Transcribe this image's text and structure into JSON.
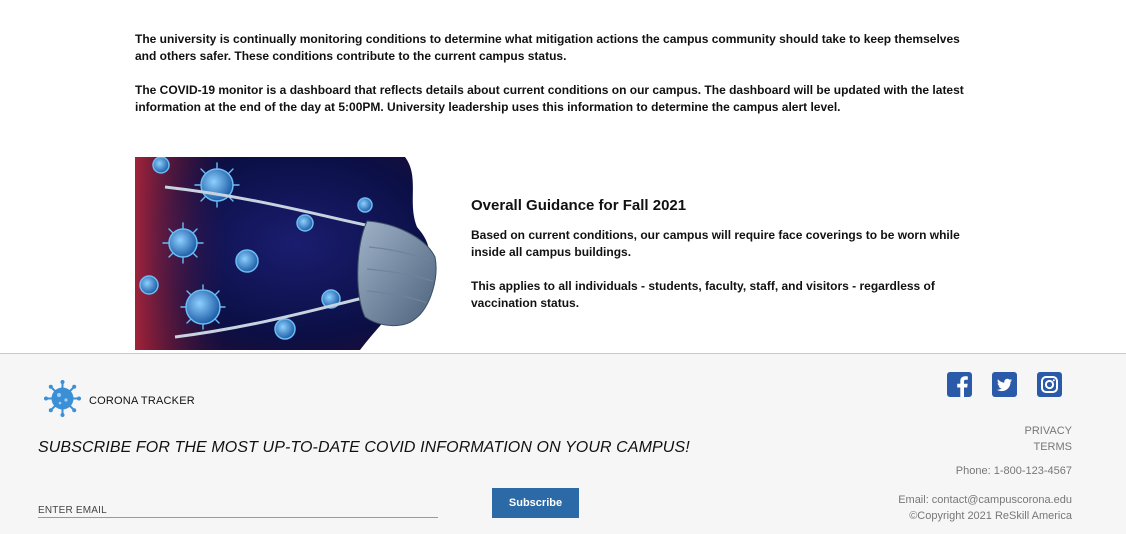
{
  "intro": {
    "paragraph_1": "The university is continually monitoring conditions to determine what mitigation actions the campus community should take to keep themselves and others safer. These conditions contribute to the current campus status.",
    "paragraph_2": "The COVID-19 monitor is a dashboard that reflects details about current conditions on our campus. The dashboard will be updated with the latest information at the end of the day at 5:00PM. University leadership uses this information to determine the campus alert level."
  },
  "guidance": {
    "title": "Overall Guidance for Fall 2021",
    "paragraph_1": "Based on current conditions, our campus will require face coverings to be worn while inside all campus buildings.",
    "paragraph_2": "This applies to all individuals - students, faculty, staff, and visitors - regardless of vaccination status."
  },
  "footer": {
    "brand_name": "CORONA TRACKER",
    "subscribe_heading": "SUBSCRIBE FOR THE MOST UP-TO-DATE COVID INFORMATION ON YOUR CAMPUS!",
    "email_placeholder": "ENTER EMAIL",
    "subscribe_label": "Subscribe",
    "links": [
      "PRIVACY",
      "TERMS"
    ],
    "phone": "Phone: 1-800-123-4567",
    "email": "Email: contact@campuscorona.edu",
    "copyright": "©Copyright 2021 ReSkill America",
    "social_icons": [
      "facebook-icon",
      "twitter-icon",
      "instagram-icon"
    ]
  },
  "colors": {
    "accent": "#2c6aa7",
    "social_icon": "#2b5aa8",
    "footer_bg": "#f6f6f6",
    "virus_blue": "#3a8fd6"
  }
}
